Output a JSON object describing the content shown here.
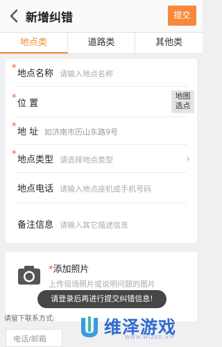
{
  "header": {
    "title": "新增纠错",
    "submit_label": "提交"
  },
  "tabs": [
    {
      "label": "地点类",
      "active": true
    },
    {
      "label": "道路类",
      "active": false
    },
    {
      "label": "其他类",
      "active": false
    }
  ],
  "form": {
    "required_mark": "*",
    "name": {
      "label": "地点名称",
      "placeholder": "请输入地点名称"
    },
    "position": {
      "label": "位 置",
      "map_button": [
        "地图",
        "选点"
      ]
    },
    "address": {
      "label": "地 址",
      "value": "如济南市历山东路9号"
    },
    "type": {
      "label": "地点类型",
      "placeholder": "请选择地点类型",
      "chevron": "›"
    },
    "phone": {
      "label": "地点电话",
      "placeholder": "请输入地点座机或手机号码"
    },
    "note": {
      "label": "备注信息",
      "placeholder": "请输入其它描述信息"
    }
  },
  "photo": {
    "title": "添加照片",
    "desc": "上传现场照片或说明问题的图片",
    "icon": "camera-icon"
  },
  "contact": {
    "label": "请留下联系方式:",
    "placeholder": "电话/邮箱"
  },
  "toast": "请登录后再进行提交纠错信息!",
  "watermark": {
    "text": "维泽游戏",
    "sub": "WWW.WIZED.VIP"
  },
  "colors": {
    "accent": "#f28a2e",
    "submit_bg": "#f7893c",
    "required": "#e55a2c",
    "watermark": "#2f6bd2"
  }
}
